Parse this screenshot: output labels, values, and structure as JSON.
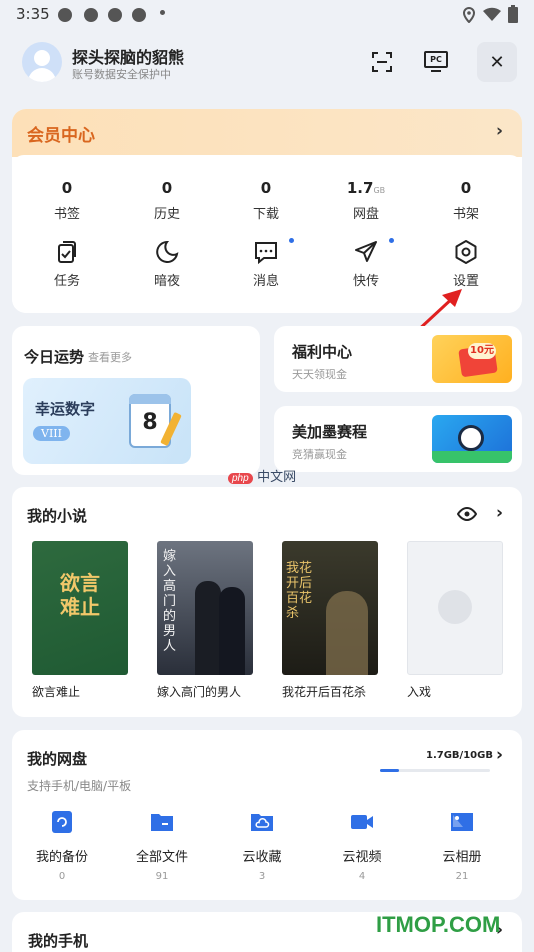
{
  "status_bar": {
    "time": "3:35"
  },
  "user": {
    "name": "探头探脑的貂熊",
    "subtitle": "账号数据安全保护中"
  },
  "header": {
    "pc_label": "PC",
    "close_symbol": "✕"
  },
  "member_center": {
    "title": "会员中心",
    "arrow": "›",
    "stats": [
      {
        "value": "0",
        "unit": "",
        "label": "书签"
      },
      {
        "value": "0",
        "unit": "",
        "label": "历史"
      },
      {
        "value": "0",
        "unit": "",
        "label": "下载"
      },
      {
        "value": "1.7",
        "unit": "GB",
        "label": "网盘"
      },
      {
        "value": "0",
        "unit": "",
        "label": "书架"
      }
    ],
    "tools": [
      {
        "label": "任务",
        "icon": "task-icon"
      },
      {
        "label": "暗夜",
        "icon": "moon-icon"
      },
      {
        "label": "消息",
        "icon": "message-icon"
      },
      {
        "label": "快传",
        "icon": "send-icon"
      },
      {
        "label": "设置",
        "icon": "settings-icon"
      }
    ]
  },
  "fortune": {
    "title": "今日运势",
    "more": "查看更多",
    "lucky_title": "幸运数字",
    "lucky_badge": "VIII",
    "lucky_number": "8"
  },
  "welfare": {
    "title": "福利中心",
    "subtitle": "天天领现金",
    "badge": "10元"
  },
  "match": {
    "title": "美加墨赛程",
    "subtitle": "竞猜赢现金"
  },
  "watermark": {
    "text": "中文网",
    "logo": "php"
  },
  "novels": {
    "title": "我的小说",
    "books": [
      {
        "title": "欲言难止",
        "cover_text": "欲言难止"
      },
      {
        "title": "嫁入高门的男人",
        "cover_text": "嫁入高门的男人"
      },
      {
        "title": "我花开后百花杀",
        "cover_text": "我花开后百花杀"
      },
      {
        "title": "入戏",
        "cover_text": ""
      }
    ]
  },
  "disk": {
    "title": "我的网盘",
    "usage": "1.7GB/10GB",
    "usage_fraction": 0.17,
    "subtitle": "支持手机/电脑/平板",
    "items": [
      {
        "label": "我的备份",
        "count": "0",
        "icon": "backup-icon"
      },
      {
        "label": "全部文件",
        "count": "91",
        "icon": "folder-icon"
      },
      {
        "label": "云收藏",
        "count": "3",
        "icon": "cloud-folder-icon"
      },
      {
        "label": "云视频",
        "count": "4",
        "icon": "video-icon"
      },
      {
        "label": "云相册",
        "count": "21",
        "icon": "album-icon"
      }
    ]
  },
  "phone": {
    "title": "我的手机"
  },
  "site_watermark": {
    "text": "ITMOP.COM"
  },
  "colors": {
    "accent": "#2f6fe6",
    "member_title": "#d9661f",
    "arrow": "#e02020"
  }
}
